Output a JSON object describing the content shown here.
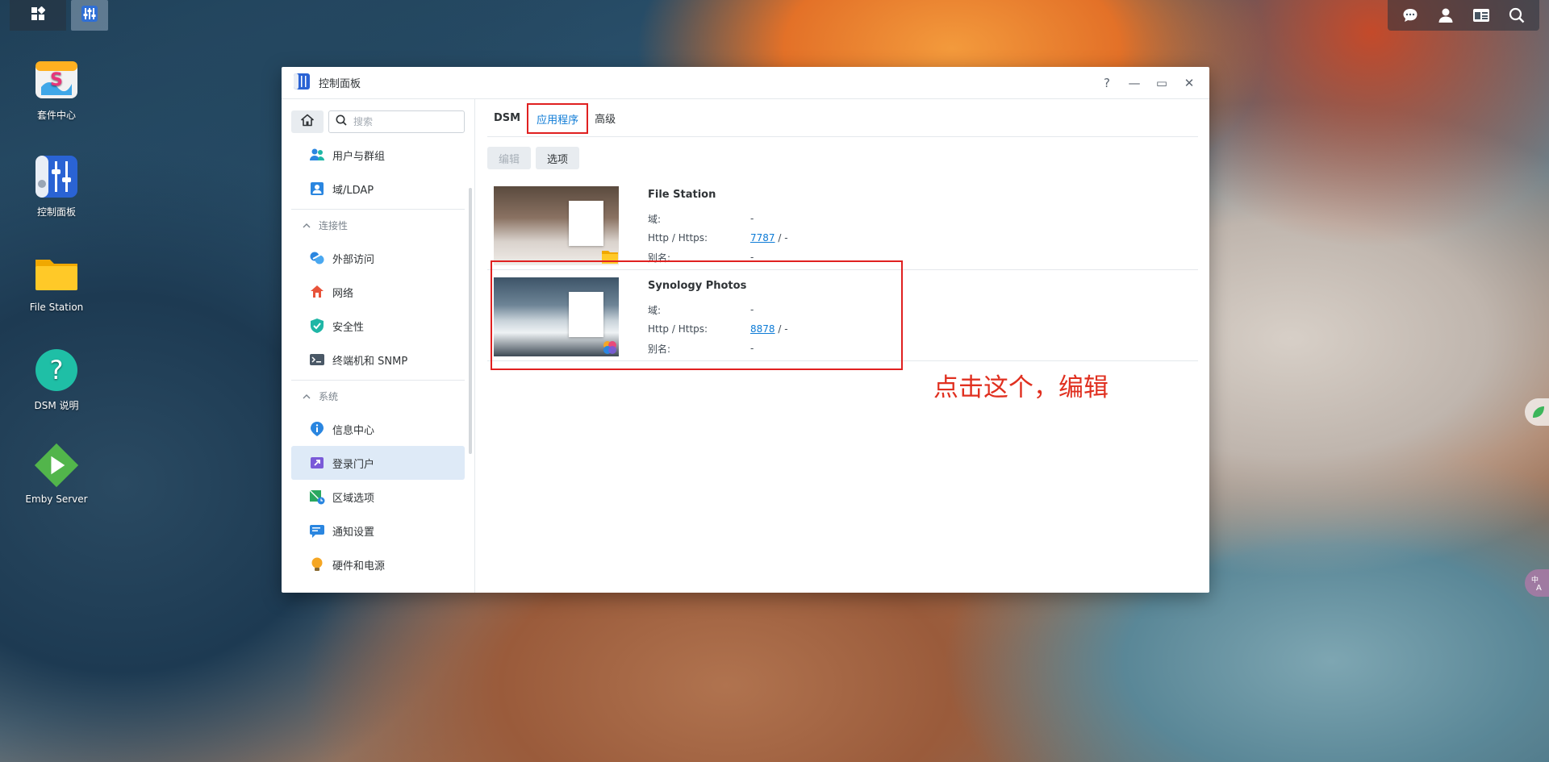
{
  "taskbar": {
    "left_icons": [
      "grid-icon",
      "control-panel-icon"
    ],
    "right_icons": [
      "chat-icon",
      "user-icon",
      "widget-icon",
      "search-icon"
    ]
  },
  "desktop": {
    "icons": [
      {
        "label": "套件中心",
        "icon": "package-center-icon"
      },
      {
        "label": "控制面板",
        "icon": "control-panel-icon"
      },
      {
        "label": "File Station",
        "icon": "folder-icon"
      },
      {
        "label": "DSM 说明",
        "icon": "help-icon"
      },
      {
        "label": "Emby Server",
        "icon": "emby-icon"
      }
    ]
  },
  "window": {
    "title": "控制面板",
    "controls": {
      "help": "?",
      "minimize": "—",
      "maximize": "▭",
      "close": "✕"
    }
  },
  "sidebar": {
    "search_placeholder": "搜索",
    "items_top": [
      {
        "label": "用户与群组",
        "icon": "users-icon"
      },
      {
        "label": "域/LDAP",
        "icon": "ldap-icon"
      }
    ],
    "section_connectivity": "连接性",
    "items_connectivity": [
      {
        "label": "外部访问",
        "icon": "external-access-icon"
      },
      {
        "label": "网络",
        "icon": "network-icon"
      },
      {
        "label": "安全性",
        "icon": "shield-icon"
      },
      {
        "label": "终端机和 SNMP",
        "icon": "terminal-icon"
      }
    ],
    "section_system": "系统",
    "items_system": [
      {
        "label": "信息中心",
        "icon": "info-icon"
      },
      {
        "label": "登录门户",
        "icon": "login-portal-icon",
        "selected": true
      },
      {
        "label": "区域选项",
        "icon": "region-icon"
      },
      {
        "label": "通知设置",
        "icon": "notification-icon"
      },
      {
        "label": "硬件和电源",
        "icon": "power-icon"
      }
    ]
  },
  "main": {
    "tabs": [
      {
        "label": "DSM"
      },
      {
        "label": "应用程序",
        "active": true
      },
      {
        "label": "高级"
      }
    ],
    "toolbar": {
      "edit_label": "编辑",
      "options_label": "选项"
    },
    "field_labels": {
      "domain": "域:",
      "http": "Http / Https:",
      "alias": "别名:"
    },
    "apps": [
      {
        "name": "File Station",
        "domain": "-",
        "http_port": "7787",
        "https_port": "/ -",
        "alias": "-"
      },
      {
        "name": "Synology Photos",
        "domain": "-",
        "http_port": "8878",
        "https_port": "/ -",
        "alias": "-"
      }
    ]
  },
  "annotation": {
    "text": "点击这个，编辑",
    "color": "#e02020"
  },
  "colors": {
    "accent": "#0d7bd6",
    "selected_bg": "#deeaf7",
    "annotation_red": "#e02020"
  }
}
